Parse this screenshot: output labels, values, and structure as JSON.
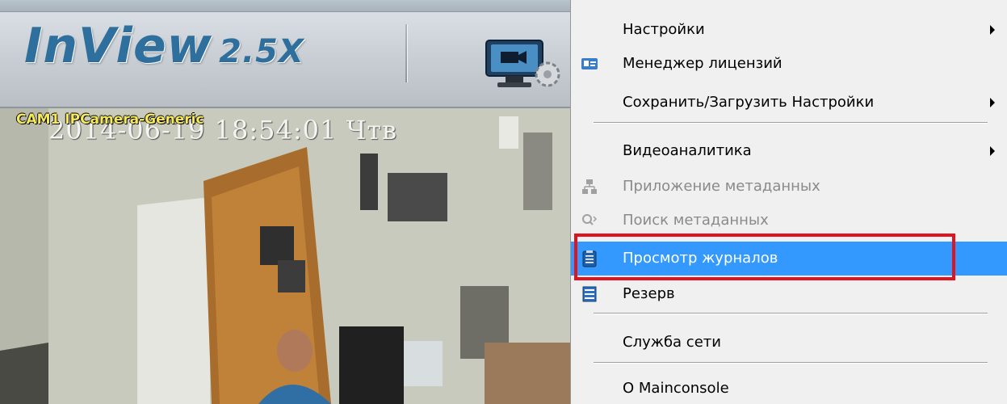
{
  "app": {
    "brand_name": "InView",
    "brand_version": "2.5X"
  },
  "camera": {
    "label": "CAM1 IPCamera-Generic",
    "timestamp": "2014-06-19 18:54:01 Чтв"
  },
  "menu": {
    "items": [
      {
        "label": "Настройки",
        "icon": "",
        "submenu": true,
        "disabled": false,
        "selected": false
      },
      {
        "label": "Менеджер лицензий",
        "icon": "license-card-icon",
        "submenu": false,
        "disabled": false,
        "selected": false
      },
      {
        "label": "Сохранить/Загрузить Настройки",
        "icon": "",
        "submenu": true,
        "disabled": false,
        "selected": false
      },
      {
        "label": "Видеоаналитика",
        "icon": "",
        "submenu": true,
        "disabled": false,
        "selected": false
      },
      {
        "label": "Приложение метаданных",
        "icon": "network-tree-icon",
        "submenu": false,
        "disabled": true,
        "selected": false
      },
      {
        "label": "Поиск метаданных",
        "icon": "metadata-search-icon",
        "submenu": false,
        "disabled": true,
        "selected": false
      },
      {
        "label": "Просмотр журналов",
        "icon": "log-clipboard-icon",
        "submenu": false,
        "disabled": false,
        "selected": true
      },
      {
        "label": "Резерв",
        "icon": "backup-list-icon",
        "submenu": false,
        "disabled": false,
        "selected": false
      },
      {
        "label": "Служба сети",
        "icon": "",
        "submenu": false,
        "disabled": false,
        "selected": false
      },
      {
        "label": "О Mainconsole",
        "icon": "",
        "submenu": false,
        "disabled": false,
        "selected": false
      }
    ]
  },
  "colors": {
    "brand": "#2e6f9e",
    "selection": "#3399ff",
    "annotation_box": "#e0141e",
    "overlay_label": "#f5e85a"
  }
}
